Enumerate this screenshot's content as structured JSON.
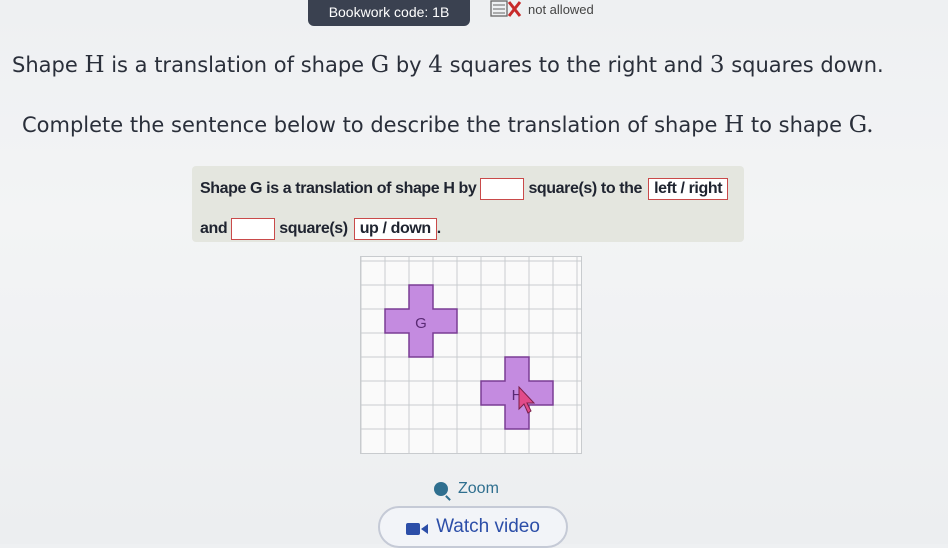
{
  "header": {
    "bookwork_label": "Bookwork code: 1B",
    "calculator_status": "not allowed"
  },
  "question": {
    "line1_a": "Shape",
    "line1_h": "H",
    "line1_b": "is a translation of shape",
    "line1_g": "G",
    "line1_c": "by",
    "line1_n1": "4",
    "line1_d": "squares to the right and",
    "line1_n2": "3",
    "line1_e": "squares down.",
    "line2_a": "Complete the sentence below to describe the translation of shape",
    "line2_h": "H",
    "line2_b": "to shape",
    "line2_g": "G."
  },
  "sentence": {
    "part1": "Shape G is a translation of shape H by",
    "part2": "square(s) to the",
    "choice1": "left / right",
    "part3": "and",
    "part4": "square(s)",
    "choice2": "up / down",
    "end": "."
  },
  "grid": {
    "label_g": "G",
    "label_h": "H",
    "fill_color": "#c48be0"
  },
  "controls": {
    "zoom_label": "Zoom",
    "watch_label": "Watch video"
  }
}
